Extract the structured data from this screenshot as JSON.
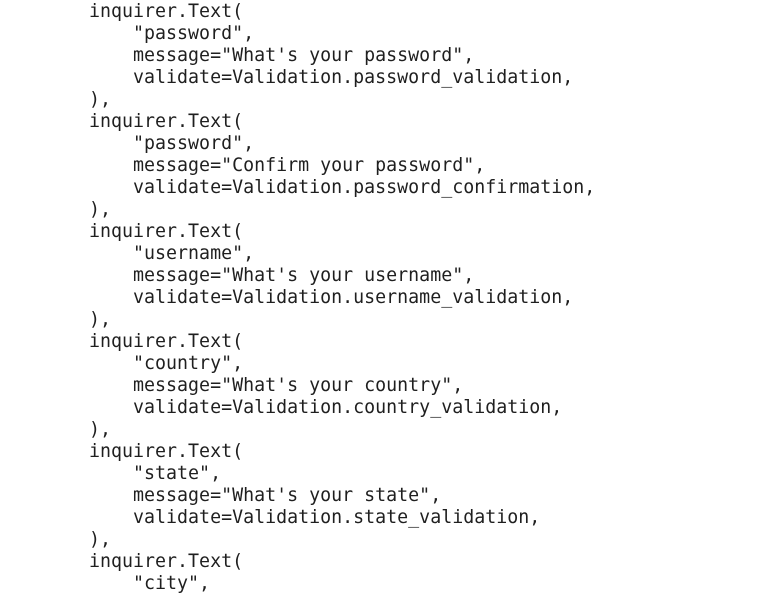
{
  "code": {
    "lines": [
      "inquirer.Text(",
      "    \"password\",",
      "    message=\"What's your password\",",
      "    validate=Validation.password_validation,",
      "),",
      "inquirer.Text(",
      "    \"password\",",
      "    message=\"Confirm your password\",",
      "    validate=Validation.password_confirmation,",
      "),",
      "inquirer.Text(",
      "    \"username\",",
      "    message=\"What's your username\",",
      "    validate=Validation.username_validation,",
      "),",
      "inquirer.Text(",
      "    \"country\",",
      "    message=\"What's your country\",",
      "    validate=Validation.country_validation,",
      "),",
      "inquirer.Text(",
      "    \"state\",",
      "    message=\"What's your state\",",
      "    validate=Validation.state_validation,",
      "),",
      "inquirer.Text(",
      "    \"city\","
    ]
  }
}
